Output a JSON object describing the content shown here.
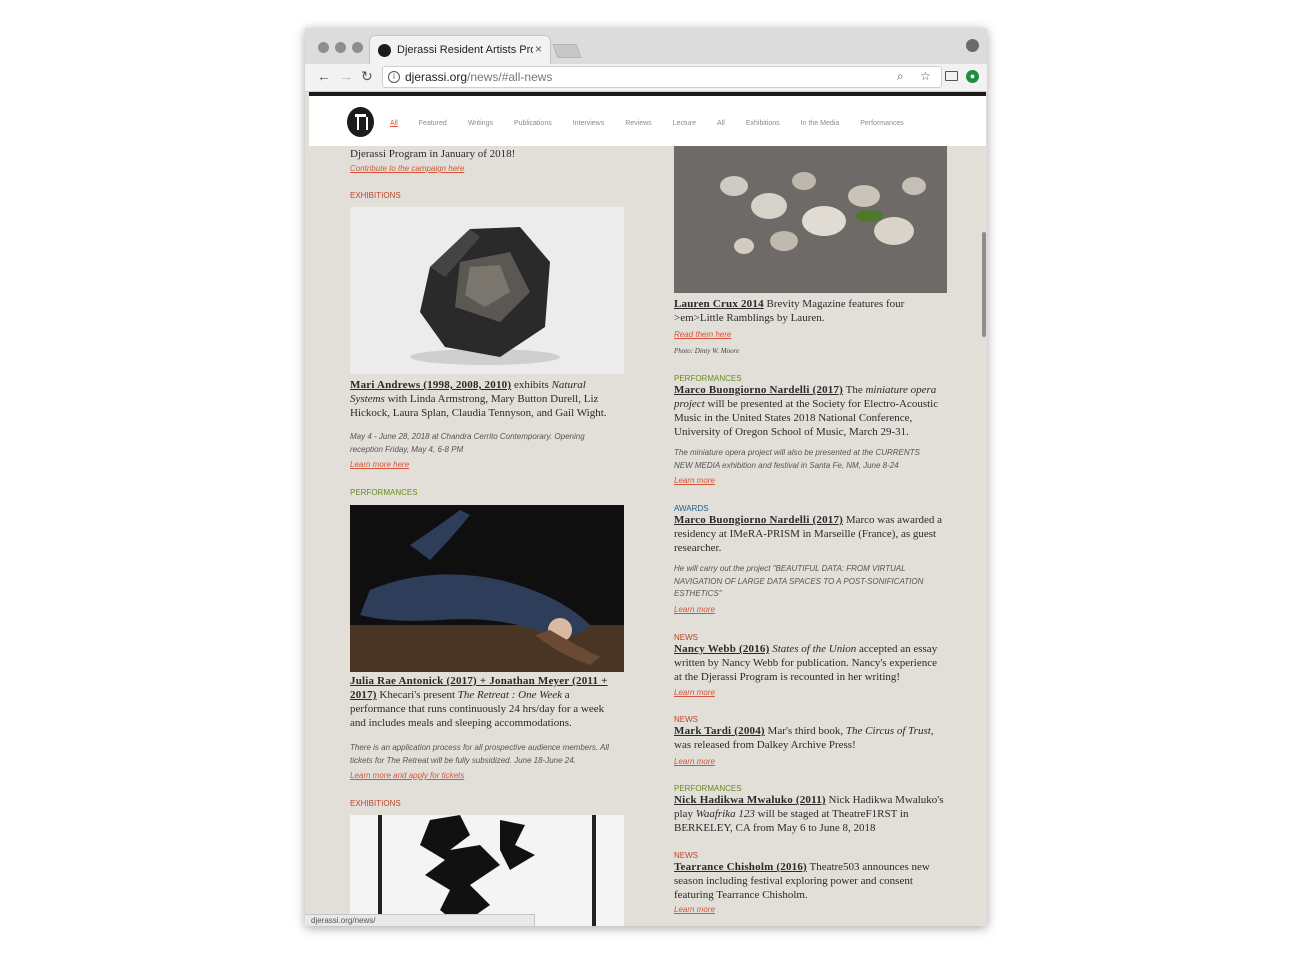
{
  "browser": {
    "tab_title": "Djerassi Resident Artists Progr",
    "tab_close": "×",
    "url_host": "djerassi.org",
    "url_path": "/news/#all-news",
    "status_url": "djerassi.org/news/",
    "nav_back": "←",
    "nav_forward": "→",
    "nav_reload": "↻",
    "info_glyph": "i",
    "zoom_glyph": "⌕",
    "star_glyph": "☆",
    "ext_glyph": "●"
  },
  "site_nav": {
    "items": [
      "All",
      "Featured",
      "Writings",
      "Publications",
      "Interviews",
      "Reviews",
      "Lecture",
      "All",
      "Exhibitions",
      "In the Media",
      "Performances"
    ],
    "active_index": 0
  },
  "left_column": {
    "intro_text": "Djerassi Program in January of 2018!",
    "intro_link": "Contribute to the campaign here",
    "entries": [
      {
        "category": "EXHIBITIONS",
        "name": "Mari Andrews (1998, 2008, 2010)",
        "text_a": " exhibits ",
        "text_italic": "Natural Systems",
        "text_b": " with Linda Armstrong, Mary Button Durell, Liz Hickock, Laura Splan, Claudia Tennyson, and Gail Wight.",
        "note": "May 4 - June 28, 2018 at Chandra Cerrito Contemporary. Opening reception Friday, May 4, 6-8 PM",
        "link": "Learn more here"
      },
      {
        "category": "PERFORMANCES",
        "name": "Julia Rae Antonick (2017) + Jonathan Meyer (2011 + 2017)",
        "text_a": " Khecari's present ",
        "text_italic": "The Retreat : One Week",
        "text_b": " a performance that runs continuously 24 hrs/day for a week and includes meals and sleeping accommodations.",
        "note": "There is an application process for all prospective audience members. All tickets for The Retreat will be fully subsidized. June 18-June 24.",
        "link": "Learn more and apply for tickets"
      },
      {
        "category": "EXHIBITIONS"
      }
    ]
  },
  "right_column": {
    "entries": [
      {
        "name": "Lauren Crux 2014",
        "text": " Brevity Magazine features four >em>Little Ramblings by Lauren.",
        "link": "Read them here",
        "credit": "Photo: Dinty W. Moore"
      },
      {
        "category": "PERFORMANCES",
        "name": "Marco Buongiorno Nardelli (2017)",
        "text_a": " The ",
        "text_italic": "miniature opera project",
        "text_b": " will be presented at the Society for Electro-Acoustic Music in the United States 2018 National Conference, University of Oregon School of Music, March 29-31.",
        "note": "The miniature opera project will also be presented at the CURRENTS NEW MEDIA exhibition and festival in Santa Fe, NM, June 8-24",
        "link": "Learn more"
      },
      {
        "category": "AWARDS",
        "name": "Marco Buongiorno Nardelli (2017)",
        "text": " Marco was awarded a residency at IMeRA-PRISM in Marseille (France), as guest researcher.",
        "note": "He will carry out the project \"BEAUTIFUL DATA: FROM VIRTUAL NAVIGATION OF LARGE DATA SPACES TO A POST-SONIFICATION ESTHETICS\"",
        "link": "Learn more"
      },
      {
        "category": "NEWS",
        "name": "Nancy Webb (2016)",
        "text_a": " ",
        "text_italic": "States of the Union",
        "text_b": " accepted an essay written by Nancy Webb for publication. Nancy's experience at the Djerassi Program is recounted in her writing!",
        "link": "Learn more"
      },
      {
        "category": "NEWS",
        "name": "Mark Tardi (2004)",
        "text_a": " Mar's third book, ",
        "text_italic": "The Circus of Trust,",
        "text_b": " was released from Dalkey Archive Press!",
        "link": "Learn more"
      },
      {
        "category": "PERFORMANCES",
        "name": "Nick Hadikwa Mwaluko (2011)",
        "text_a": " Nick Hadikwa Mwaluko's play ",
        "text_italic": "Waafrika 123",
        "text_b": " will be staged at TheatreF1RST in BERKELEY, CA from May 6 to June 8, 2018"
      },
      {
        "category": "NEWS",
        "name": "Tearrance Chisholm (2016)",
        "text": " Theatre503 announces new season including festival exploring power and consent featuring Tearrance Chisholm.",
        "link": "Learn more"
      }
    ]
  },
  "colors": {
    "accent_link": "#d4553a",
    "cat_exhibitions": "#c0442a",
    "cat_performances": "#6a8a1f",
    "cat_awards": "#1f5f8e",
    "page_bg": "#e2dfd9"
  }
}
